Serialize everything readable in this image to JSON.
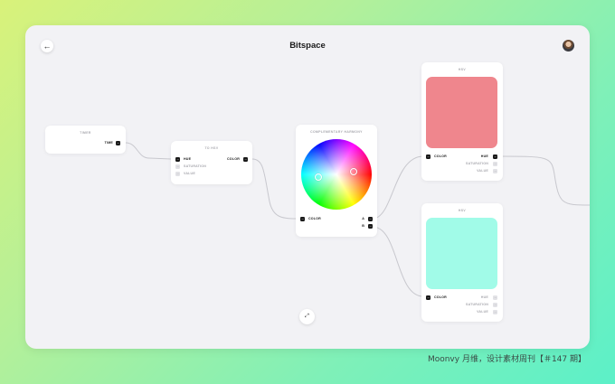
{
  "window": {
    "title": "Bitspace"
  },
  "icons": {
    "back": "arrow-left-icon",
    "avatar": "user-avatar",
    "fit": "expand-icon"
  },
  "nodes": {
    "timer": {
      "title": "TIMER",
      "output": "TIME"
    },
    "to_hsv": {
      "title": "TO HSV",
      "inputs": [
        "HUE",
        "SATURATION",
        "VALUE"
      ],
      "output": "COLOR"
    },
    "harmony": {
      "title": "COMPLEMENTARY HARMONY",
      "input": "COLOR",
      "outputs": [
        "A",
        "B"
      ]
    },
    "hsv_top": {
      "title": "HSV",
      "input": "COLOR",
      "outputs": [
        "HUE",
        "SATURATION",
        "VALUE"
      ],
      "swatch_color": "#ef868d"
    },
    "hsv_bottom": {
      "title": "HSV",
      "input": "COLOR",
      "outputs": [
        "HUE",
        "SATURATION",
        "VALUE"
      ],
      "swatch_color": "#a1fbe8"
    }
  },
  "watermark": "Moonvy 月维，设计素材周刊【＃147 期】"
}
